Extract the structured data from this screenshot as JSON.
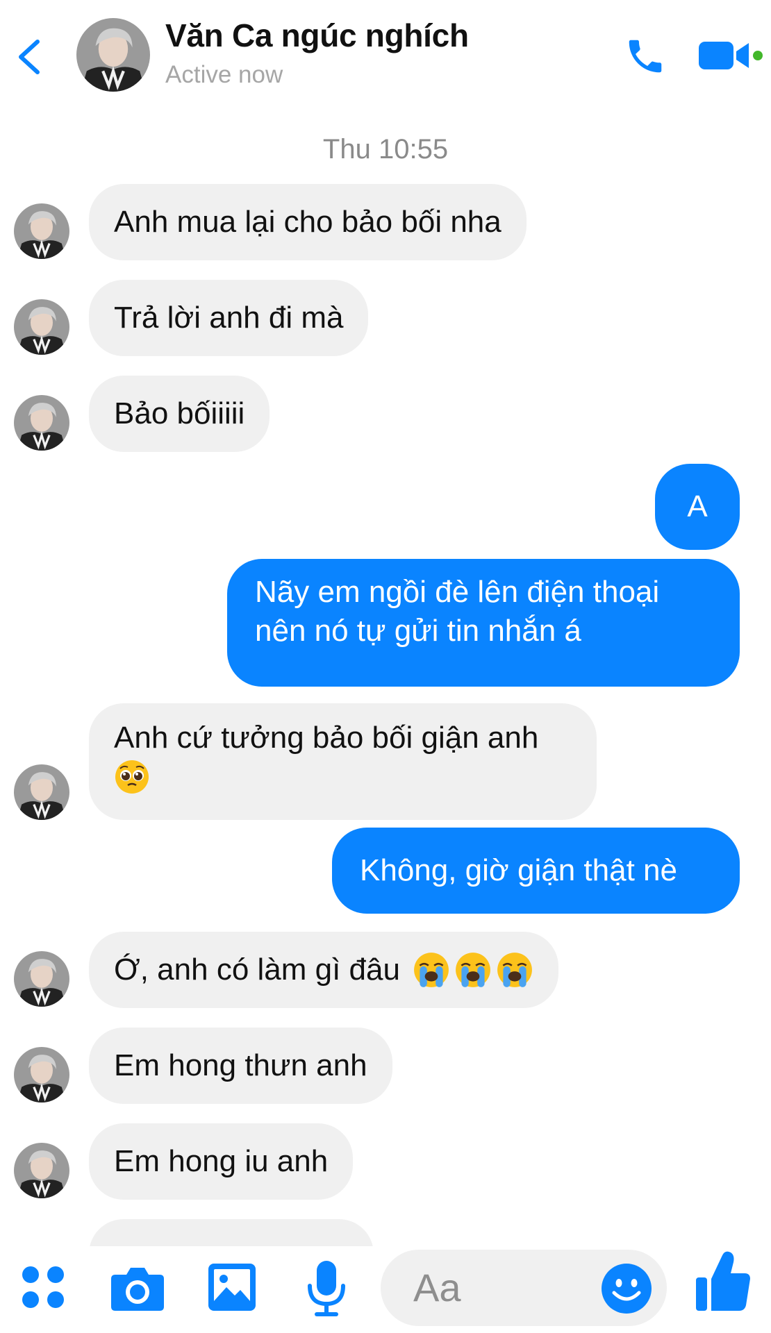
{
  "header": {
    "contact_name": "Văn Ca ngúc nghích",
    "status": "Active now"
  },
  "conversation": {
    "timestamp": "Thu 10:55",
    "messages": [
      {
        "from": "them",
        "text": "Anh mua lại cho bảo bối nha"
      },
      {
        "from": "them",
        "text": "Trả lời anh đi mà"
      },
      {
        "from": "them",
        "text": "Bảo bốiiiii"
      },
      {
        "from": "me",
        "text": "A"
      },
      {
        "from": "me",
        "line1": "Nãy em ngồi đè lên điện thoại",
        "line2": "nên nó tự gửi tin nhắn á"
      },
      {
        "from": "them",
        "line1": "Anh cứ tưởng bảo bối giận anh",
        "emoji": "pleading-face"
      },
      {
        "from": "me",
        "text": "Không, giờ giận thật nè"
      },
      {
        "from": "them",
        "text": "Ớ, anh có làm gì đâu",
        "emoji": "loudly-crying-face x3"
      },
      {
        "from": "them",
        "text": "Em hong thưn anh"
      },
      {
        "from": "them",
        "text": "Em hong iu anh"
      }
    ]
  },
  "composer": {
    "placeholder": "Aa"
  },
  "colors": {
    "accent": "#0a84ff",
    "incoming_bubble": "#f0f0f0",
    "online_dot": "#42b72a"
  }
}
